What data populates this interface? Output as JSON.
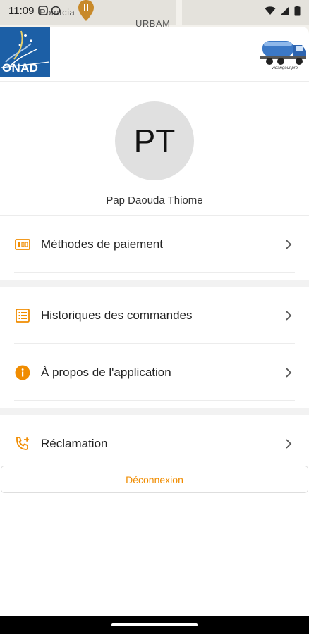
{
  "status_bar": {
    "time": "11:09",
    "map_labels": [
      "Pointcia",
      "URBAM"
    ]
  },
  "header": {
    "left_logo_text": "ONAD",
    "right_logo_caption": "Vidangeur.pro"
  },
  "profile": {
    "initials": "PT",
    "name": "Pap Daouda Thiome"
  },
  "menu": {
    "payment": {
      "label": "Méthodes de paiement",
      "icon": "payment-card-icon"
    },
    "orders": {
      "label": "Historiques des commandes",
      "icon": "list-icon"
    },
    "about": {
      "label": "À propos de l'application",
      "icon": "info-icon"
    },
    "claims": {
      "label": "Réclamation",
      "icon": "phone-forward-icon"
    }
  },
  "logout": {
    "label": "Déconnexion"
  },
  "colors": {
    "accent": "#f08c00",
    "onad_blue": "#1c5fa6"
  }
}
